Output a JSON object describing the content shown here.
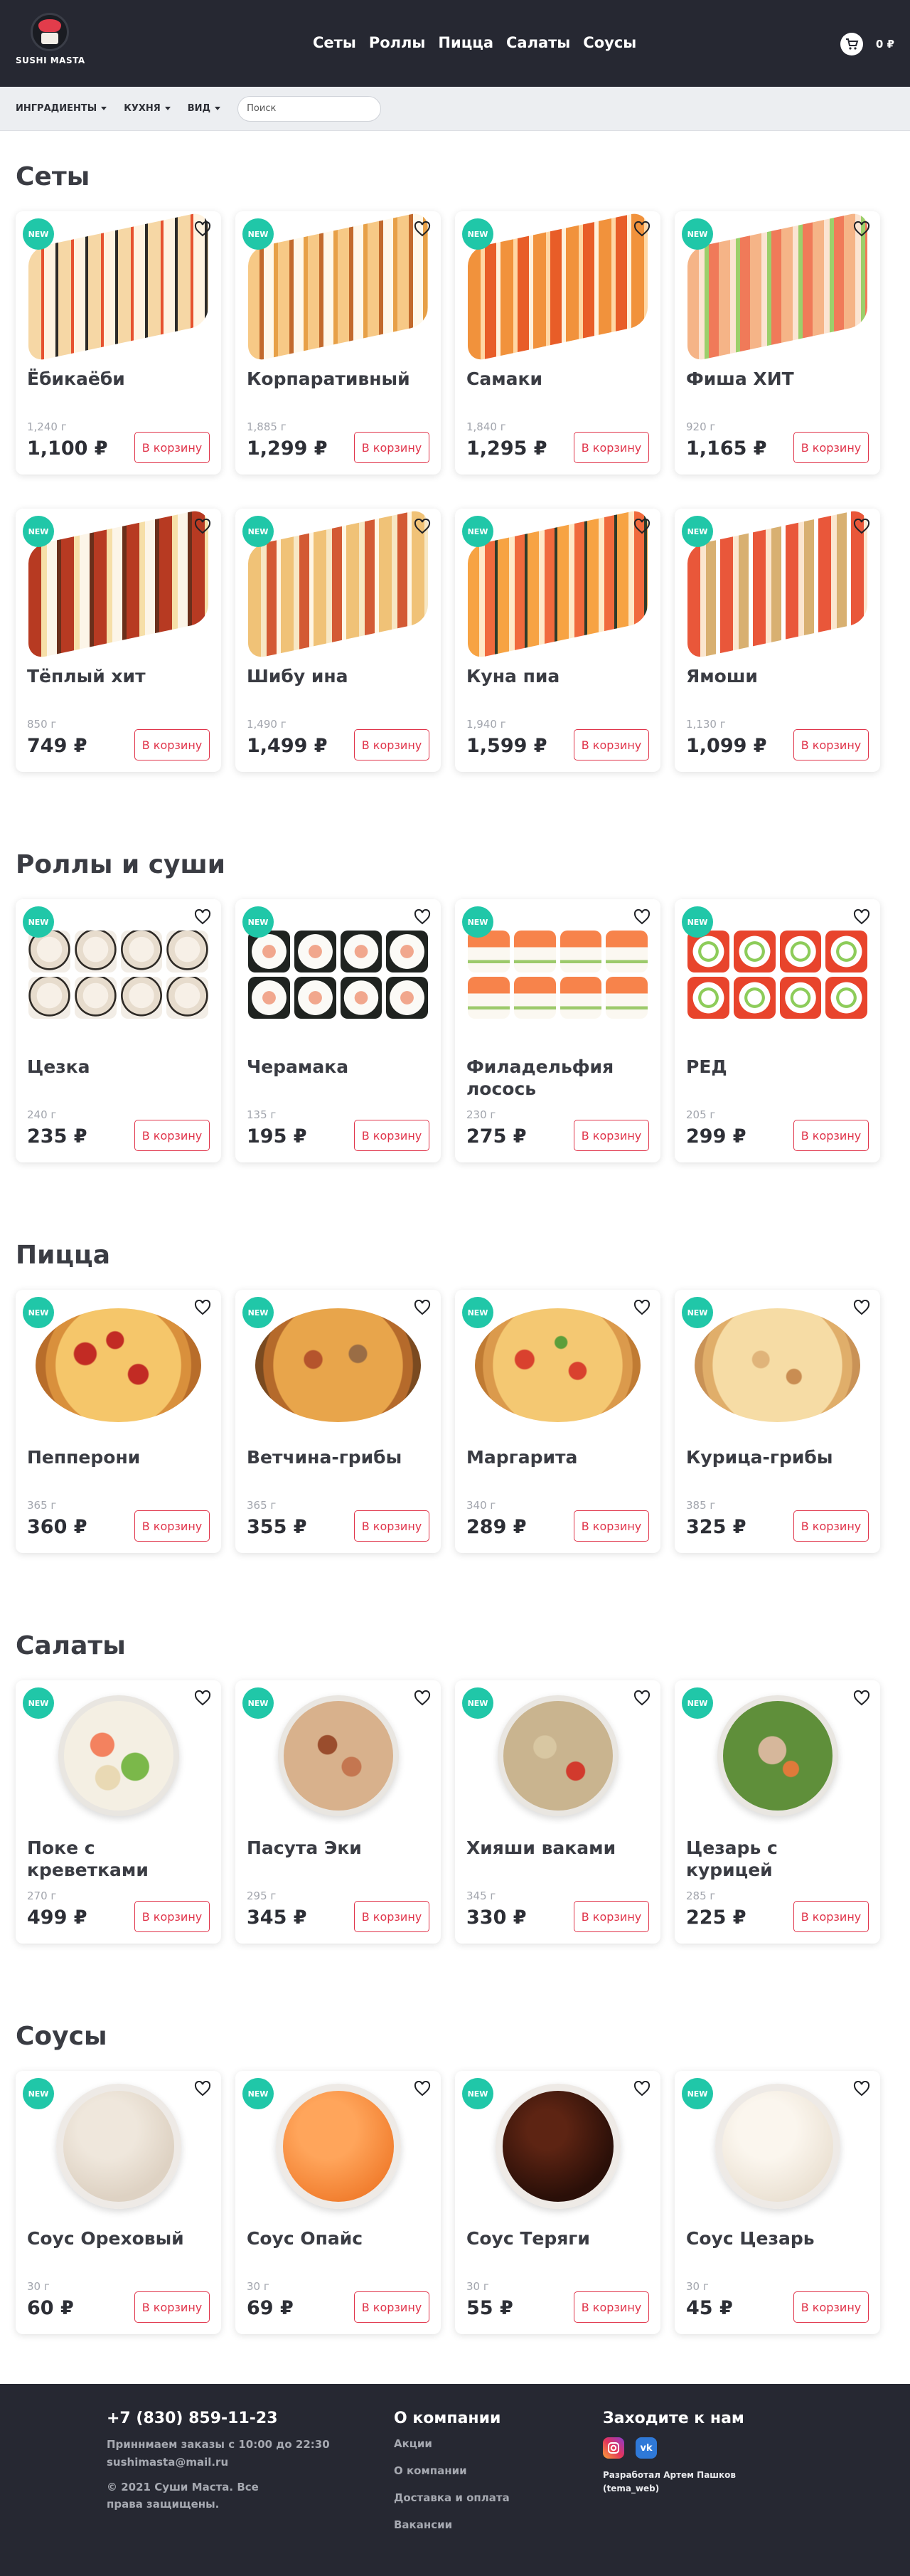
{
  "header": {
    "logo_text": "SUSHI MASTA",
    "nav": [
      "Сеты",
      "Роллы",
      "Пицца",
      "Салаты",
      "Соусы"
    ],
    "cart_total": "0 ₽"
  },
  "filters": {
    "ingredients": "ИНГРАДИЕНТЫ",
    "cuisine": "КУХНЯ",
    "view": "ВИД",
    "search_placeholder": "Поиск"
  },
  "common": {
    "new_badge": "NEW",
    "buy_label": "В корзину"
  },
  "sections": [
    {
      "title": "Сеты",
      "items": [
        {
          "name": "Ёбикаёби",
          "weight": "1,240 г",
          "price": "1,100 ₽"
        },
        {
          "name": "Корпаративный",
          "weight": "1,885 г",
          "price": "1,299 ₽"
        },
        {
          "name": "Самаки",
          "weight": "1,840 г",
          "price": "1,295 ₽"
        },
        {
          "name": "Фиша ХИТ",
          "weight": "920 г",
          "price": "1,165 ₽"
        },
        {
          "name": "Тёплый хит",
          "weight": "850 г",
          "price": "749 ₽"
        },
        {
          "name": "Шибу ина",
          "weight": "1,490 г",
          "price": "1,499 ₽"
        },
        {
          "name": "Куна пиа",
          "weight": "1,940 г",
          "price": "1,599 ₽"
        },
        {
          "name": "Ямоши",
          "weight": "1,130 г",
          "price": "1,099 ₽"
        }
      ]
    },
    {
      "title": "Роллы и суши",
      "items": [
        {
          "name": "Цезка",
          "weight": "240 г",
          "price": "235 ₽"
        },
        {
          "name": "Черамака",
          "weight": "135 г",
          "price": "195 ₽"
        },
        {
          "name": "Филадельфия лосось",
          "weight": "230 г",
          "price": "275 ₽"
        },
        {
          "name": "РЕД",
          "weight": "205 г",
          "price": "299 ₽"
        }
      ]
    },
    {
      "title": "Пицца",
      "items": [
        {
          "name": "Пепперони",
          "weight": "365 г",
          "price": "360 ₽"
        },
        {
          "name": "Ветчина-грибы",
          "weight": "365 г",
          "price": "355 ₽"
        },
        {
          "name": "Маргарита",
          "weight": "340 г",
          "price": "289 ₽"
        },
        {
          "name": "Курица-грибы",
          "weight": "385 г",
          "price": "325 ₽"
        }
      ]
    },
    {
      "title": "Салаты",
      "items": [
        {
          "name": "Поке с креветками",
          "weight": "270 г",
          "price": "499 ₽"
        },
        {
          "name": "Пасута Эки",
          "weight": "295 г",
          "price": "345 ₽"
        },
        {
          "name": "Хияши ваками",
          "weight": "345 г",
          "price": "330 ₽"
        },
        {
          "name": "Цезарь с курицей",
          "weight": "285 г",
          "price": "225 ₽"
        }
      ]
    },
    {
      "title": "Соусы",
      "items": [
        {
          "name": "Соус Ореховый",
          "weight": "30 г",
          "price": "60 ₽"
        },
        {
          "name": "Соус Опайс",
          "weight": "30 г",
          "price": "69 ₽"
        },
        {
          "name": "Соус Теряги",
          "weight": "30 г",
          "price": "55 ₽"
        },
        {
          "name": "Соус Цезарь",
          "weight": "30 г",
          "price": "45 ₽"
        }
      ]
    }
  ],
  "footer": {
    "phone": "+7 (830) 859-11-23",
    "hours": "Приннмаем заказы с 10:00 до 22:30 sushimasta@mail.ru",
    "copyright": "© 2021 Суши Маста. Все права защищены.",
    "company_title": "О компании",
    "company_links": [
      "Акции",
      "О компании",
      "Доставка и оплата",
      "Вакансии"
    ],
    "social_title": "Заходите к нам",
    "developer": "Разработал Артем Пашков (tema_web)"
  },
  "colors": {
    "header_bg": "#262832",
    "accent_red": "#e0344a",
    "new_badge": "#20c7a8"
  }
}
